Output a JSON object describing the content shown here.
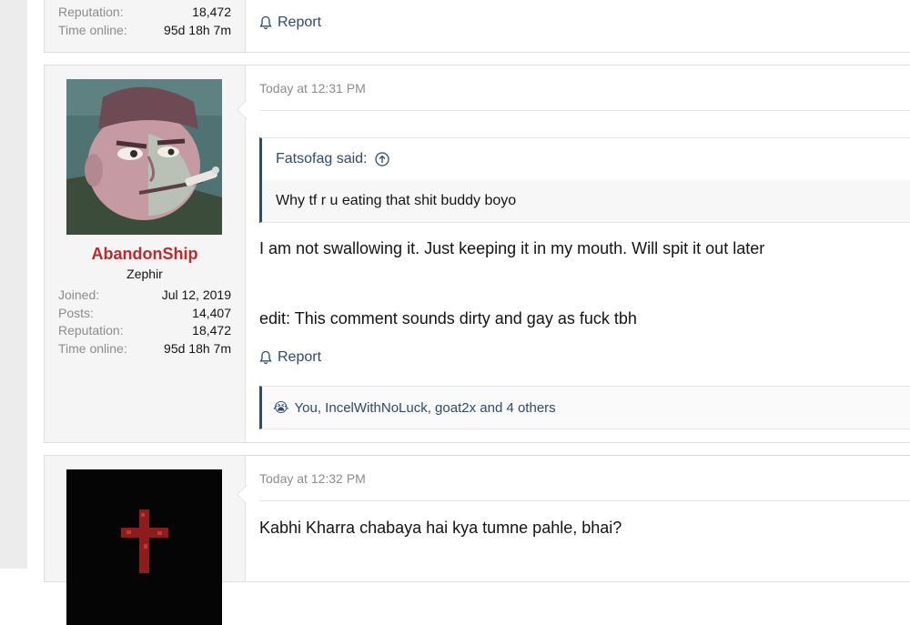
{
  "prev_post": {
    "stats": [
      {
        "label": "Reputation:",
        "value": "18,472"
      },
      {
        "label": "Time online:",
        "value": "95d 18h 7m"
      }
    ],
    "report_label": "Report"
  },
  "post1": {
    "timestamp": "Today at 12:31 PM",
    "username": "AbandonShip",
    "user_title": "Zephir",
    "stats": [
      {
        "label": "Joined:",
        "value": "Jul 12, 2019"
      },
      {
        "label": "Posts:",
        "value": "14,407"
      },
      {
        "label": "Reputation:",
        "value": "18,472"
      },
      {
        "label": "Time online:",
        "value": "95d 18h 7m"
      }
    ],
    "quote": {
      "author": "Fatsofag said:",
      "text": "Why tf r u eating that shit buddy boyo"
    },
    "body_line1": "I am not swallowing it. Just keeping it in my mouth. Will spit it out later",
    "body_line2": "edit: This comment sounds dirty and gay as fuck tbh",
    "report_label": "Report",
    "reactions": {
      "emoji": "😭",
      "text": "You, IncelWithNoLuck, goat2x and 4 others"
    }
  },
  "post2": {
    "timestamp": "Today at 12:32 PM",
    "body_line1": "Kabhi Kharra chabaya hai kya tumne pahle, bhai?"
  },
  "colors": {
    "username": "#c0282a",
    "link": "#2d4a72",
    "muted": "#8c8c8c"
  }
}
